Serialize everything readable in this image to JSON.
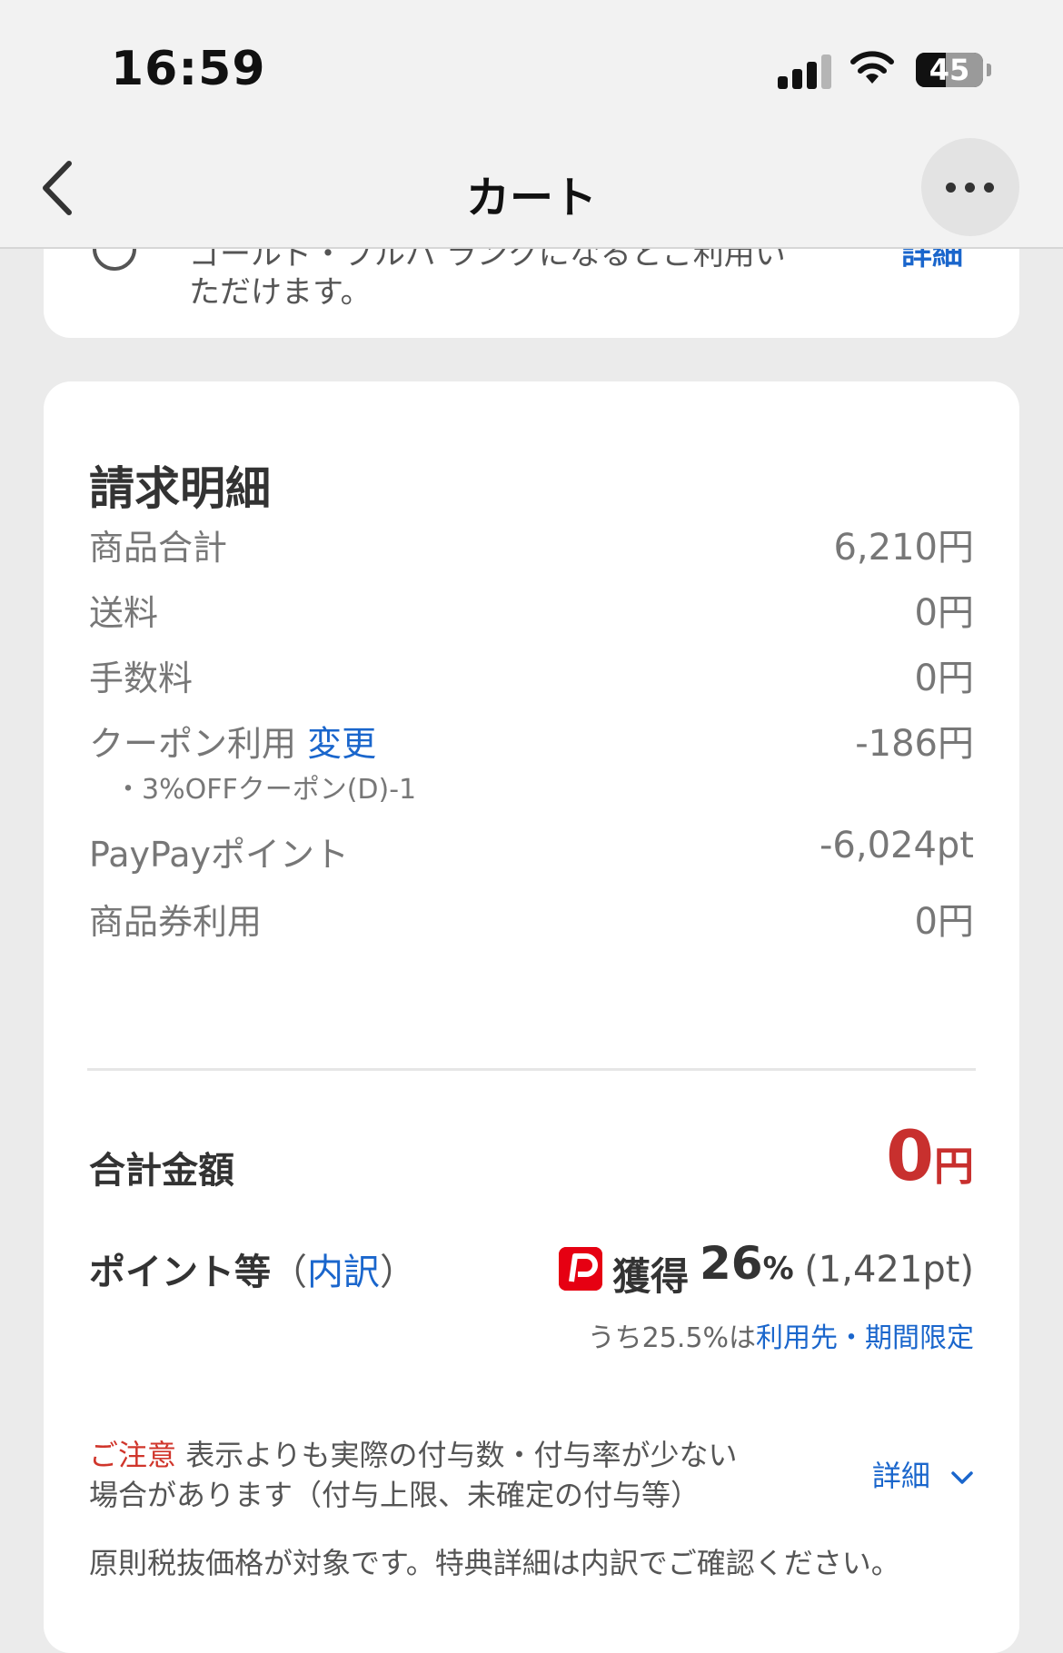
{
  "status_bar": {
    "time": "16:59",
    "battery": "45",
    "battery_level_percent": 45
  },
  "header": {
    "title": "カート",
    "more_icon": "more-horizontal-icon",
    "back_icon": "chevron-left-icon"
  },
  "top_card": {
    "line1": "ゴールド・プルバ ランクになるとご利用い",
    "line2": "ただけます。",
    "link": "詳細"
  },
  "billing": {
    "title": "請求明細",
    "rows": [
      {
        "label": "商品合計",
        "value": "6,210円"
      },
      {
        "label": "送料",
        "value": "0円"
      },
      {
        "label": "手数料",
        "value": "0円"
      },
      {
        "label": "クーポン利用",
        "link": "変更",
        "value": "-186円",
        "note": "・3%OFFクーポン(D)-1"
      },
      {
        "label": "PayPayポイント",
        "value": "-6,024pt"
      },
      {
        "label": "商品券利用",
        "value": "0円"
      }
    ],
    "total": {
      "label": "合計金額",
      "amount": "0",
      "unit": "円"
    },
    "points": {
      "label": "ポイント等",
      "open_paren": "（",
      "breakdown_link": "内訳",
      "close_paren": "）",
      "earn_label": "獲得",
      "rate": "26",
      "rate_unit": "%",
      "amount": "(1,421pt)",
      "limited_prefix": "うち25.5%は",
      "limited_link": "利用先・期間限定"
    },
    "caution": {
      "tag": "ご注意",
      "text": "表示よりも実際の付与数・付与率が少ない場合があります（付与上限、未確定の付与等）",
      "detail_link": "詳細"
    },
    "tax_note": "原則税抜価格が対象です。特典詳細は内訳でご確認ください。"
  },
  "colors": {
    "accent": "#1a66cc",
    "total_red": "#c8302e",
    "paypay_red": "#e60012"
  }
}
